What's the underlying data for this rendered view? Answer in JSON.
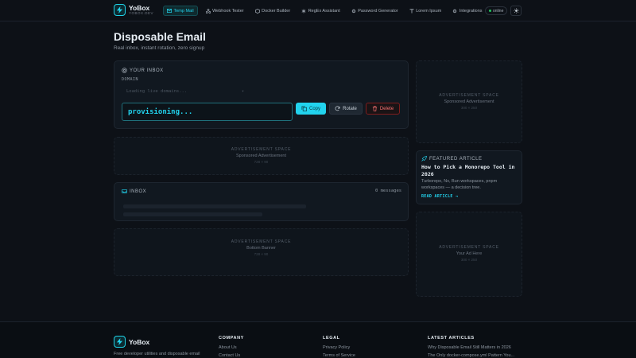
{
  "app": {
    "brand": "YoBox",
    "domain": "YOBOX.DEV"
  },
  "nav": {
    "items": [
      {
        "label": "Temp Mail",
        "icon": "mail-icon",
        "active": true
      },
      {
        "label": "Webhook Tester",
        "icon": "webhook-icon"
      },
      {
        "label": "Docker Builder",
        "icon": "docker-icon"
      },
      {
        "label": "RegEx Assistant",
        "icon": "regex-icon"
      },
      {
        "label": "Password Generator",
        "icon": "gear-icon"
      },
      {
        "label": "Lorem Ipsum",
        "icon": "text-icon"
      },
      {
        "label": "Integrations",
        "icon": "gear-icon"
      }
    ],
    "status": "online"
  },
  "hero": {
    "title": "Disposable Email",
    "subtitle": "Real inbox, instant rotation, zero signup"
  },
  "your_inbox": {
    "heading": "YOUR INBOX",
    "domain_label": "DOMAIN",
    "domain_placeholder": "Loading live domains...",
    "address": "provisioning...",
    "copy_label": "Copy",
    "rotate_label": "Rotate",
    "delete_label": "Delete"
  },
  "ads": {
    "top_mid": {
      "title": "ADVERTISEMENT SPACE",
      "sub": "Sponsored Advertisement",
      "size": "728 × 90"
    },
    "bottom": {
      "title": "ADVERTISEMENT SPACE",
      "sub": "Bottom Banner",
      "size": "728 × 90"
    },
    "side_top": {
      "title": "ADVERTISEMENT SPACE",
      "sub": "Sponsored Advertisement",
      "size": "300 × 250"
    },
    "side_bottom": {
      "title": "ADVERTISEMENT SPACE",
      "sub": "Your Ad Here",
      "size": "300 × 250"
    }
  },
  "inbox": {
    "heading": "INBOX",
    "count": "0 messages"
  },
  "featured": {
    "heading": "FEATURED ARTICLE",
    "title": "How to Pick a Monorepo Tool in 2026",
    "desc": "Turborepo, Nx, Bun workspaces, pnpm workspaces — a decision tree.",
    "link": "READ ARTICLE →"
  },
  "footer": {
    "brand": "YoBox",
    "tagline": "Free developer utilities and disposable email",
    "company_heading": "COMPANY",
    "company_links": [
      "About Us",
      "Contact Us"
    ],
    "legal_heading": "LEGAL",
    "legal_links": [
      "Privacy Policy",
      "Terms of Service"
    ],
    "articles_heading": "LATEST ARTICLES",
    "articles": [
      "Why Disposable Email Still Matters in 2026",
      "The Only docker-compose.yml Pattern You..."
    ]
  },
  "colors": {
    "accent": "#22d3ee",
    "background": "#0d1117",
    "danger": "#f87171",
    "online": "#22c55e"
  }
}
